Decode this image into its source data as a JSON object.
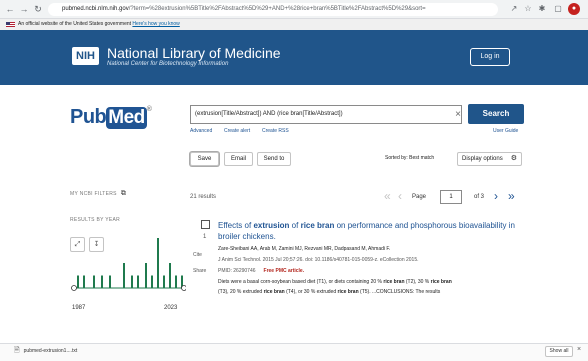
{
  "browser": {
    "url_host": "pubmed.ncbi.nlm.nih.gov",
    "url_rest": "/?term=%28extrusion%5BTitle%2FAbstract%5D%29+AND+%28rice+bran%5BTitle%2FAbstract%5D%29&sort="
  },
  "gov_banner": {
    "text": "An official website of the United States government",
    "link": "Here's how you know"
  },
  "header": {
    "logo": "NIH",
    "title": "National Library of Medicine",
    "subtitle": "National Center for Biotechnology Information",
    "login": "Log in"
  },
  "search": {
    "logo_pub": "Pub",
    "logo_med": "Med",
    "logo_reg": "®",
    "query": "(extrusion[Title/Abstract]) AND (rice bran[Title/Abstract])",
    "button": "Search",
    "advanced": "Advanced",
    "create_alert": "Create alert",
    "create_rss": "Create RSS",
    "user_guide": "User Guide"
  },
  "actions": {
    "save": "Save",
    "email": "Email",
    "send_to": "Send to",
    "sorted_by": "Sorted by: Best match",
    "display_options": "Display options"
  },
  "sidebar": {
    "my_filters": "MY NCBI FILTERS",
    "results_by_year": "RESULTS BY YEAR",
    "year_start": "1987",
    "year_end": "2023"
  },
  "results": {
    "count": "21 results",
    "page_label": "Page",
    "page_value": "1",
    "of_pages": "of 3"
  },
  "item": {
    "number": "1",
    "cite": "Cite",
    "share": "Share",
    "title_pre": "Effects of ",
    "title_b1": "extrusion",
    "title_mid": " of ",
    "title_b2": "rice bran",
    "title_post": " on performance and phosphorous bioavailability in broiler chickens.",
    "authors": "Zare-Sheibani AA, Arab M, Zamini MJ, Rezvani MR, Dadpasand M, Ahmadi F.",
    "citation": "J Anim Sci Technol. 2015 Jul 20;57:26. doi: 10.1186/s40781-015-0059-z. eCollection 2015.",
    "pmid": "PMID: 26290746",
    "free": "Free PMC article.",
    "snippet1_pre": "Diets were a basal corn-soybean based diet (T1), or diets containing 20 % ",
    "snippet1_b1": "rice bran",
    "snippet1_mid": " (T2), 30 % ",
    "snippet1_b2": "rice bran",
    "snippet2_pre": "(T3), 20 % extruded ",
    "snippet2_b1": "rice bran",
    "snippet2_mid": " (T4), or 30 % extruded ",
    "snippet2_b2": "rice bran",
    "snippet2_post": " (T5). ...CONCLUSIONS: The results"
  },
  "download": {
    "file": "pubmed-extrusion1....txt",
    "show_all": "Show all"
  },
  "colors": {
    "brand": "#20558a",
    "link": "#205493",
    "chart_bar": "#1f7a4d"
  },
  "chart_data": {
    "type": "bar",
    "x_range": [
      1987,
      2023
    ],
    "note_values": [
      1,
      1,
      1,
      1,
      1,
      2,
      1,
      1,
      2,
      1,
      4,
      1,
      2,
      1,
      1
    ]
  }
}
